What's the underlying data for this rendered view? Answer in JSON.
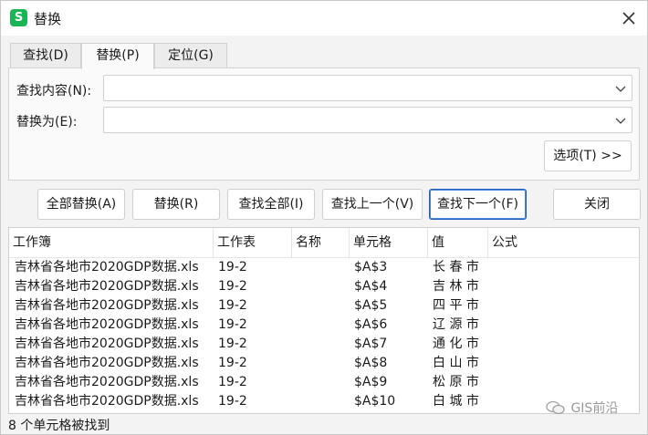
{
  "window": {
    "title": "替换",
    "app_icon_letter": "S"
  },
  "tabs": [
    {
      "label": "查找(D)"
    },
    {
      "label": "替换(P)"
    },
    {
      "label": "定位(G)"
    }
  ],
  "find": {
    "label": "查找内容(N):",
    "value": ""
  },
  "replace": {
    "label": "替换为(E):",
    "value": ""
  },
  "options_button": "选项(T) >>",
  "buttons": {
    "replace_all": "全部替换(A)",
    "replace": "替换(R)",
    "find_all": "查找全部(I)",
    "find_prev": "查找上一个(V)",
    "find_next": "查找下一个(F)",
    "close": "关闭"
  },
  "results": {
    "headers": [
      "工作簿",
      "工作表",
      "名称",
      "单元格",
      "值",
      "公式"
    ],
    "rows": [
      [
        "吉林省各地市2020GDP数据.xls",
        "19-2",
        "",
        "$A$3",
        "长 春 市",
        ""
      ],
      [
        "吉林省各地市2020GDP数据.xls",
        "19-2",
        "",
        "$A$4",
        "吉 林 市",
        ""
      ],
      [
        "吉林省各地市2020GDP数据.xls",
        "19-2",
        "",
        "$A$5",
        "四 平 市",
        ""
      ],
      [
        "吉林省各地市2020GDP数据.xls",
        "19-2",
        "",
        "$A$6",
        "辽 源 市",
        ""
      ],
      [
        "吉林省各地市2020GDP数据.xls",
        "19-2",
        "",
        "$A$7",
        "通 化 市",
        ""
      ],
      [
        "吉林省各地市2020GDP数据.xls",
        "19-2",
        "",
        "$A$8",
        "白 山 市",
        ""
      ],
      [
        "吉林省各地市2020GDP数据.xls",
        "19-2",
        "",
        "$A$9",
        "松 原 市",
        ""
      ],
      [
        "吉林省各地市2020GDP数据.xls",
        "19-2",
        "",
        "$A$10",
        "白 城 市",
        ""
      ]
    ]
  },
  "status": "8 个单元格被找到",
  "watermark": "GIS前沿",
  "colors": {
    "app_icon": "#19b455",
    "primary_border": "#1f5fbf"
  }
}
